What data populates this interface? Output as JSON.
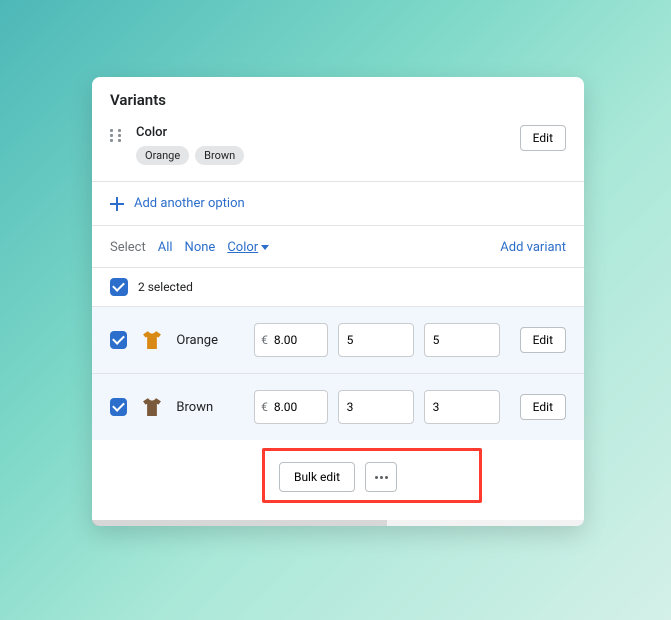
{
  "title": "Variants",
  "option": {
    "label": "Color",
    "values": [
      "Orange",
      "Brown"
    ],
    "edit": "Edit"
  },
  "add_option": "Add another option",
  "selectbar": {
    "select": "Select",
    "all": "All",
    "none": "None",
    "color": "Color",
    "add_variant": "Add variant"
  },
  "selected_text": "2 selected",
  "currency": "€",
  "rows": [
    {
      "name": "Orange",
      "price": "8.00",
      "q1": "5",
      "q2": "5",
      "edit": "Edit",
      "tcolor": "#d88a15"
    },
    {
      "name": "Brown",
      "price": "8.00",
      "q1": "3",
      "q2": "3",
      "edit": "Edit",
      "tcolor": "#7a5a3a"
    }
  ],
  "footer": {
    "bulk_edit": "Bulk edit"
  }
}
